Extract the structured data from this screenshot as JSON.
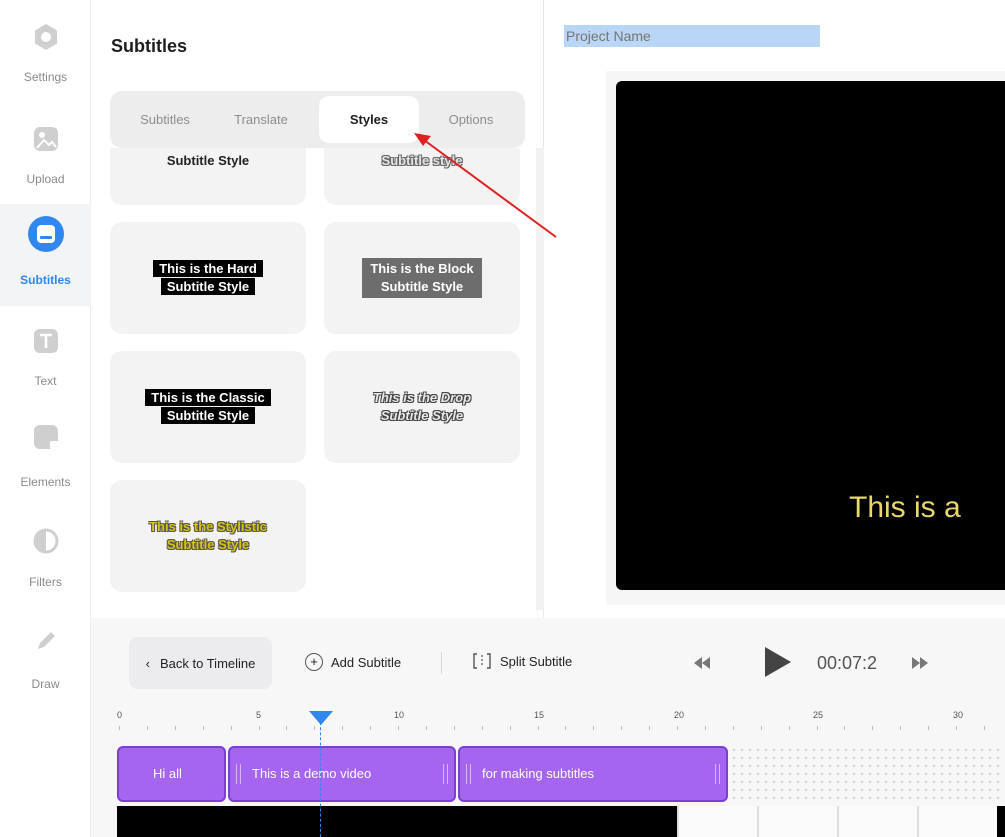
{
  "rail": {
    "items": [
      {
        "label": "Settings",
        "icon": "settings-icon"
      },
      {
        "label": "Upload",
        "icon": "upload-icon"
      },
      {
        "label": "Subtitles",
        "icon": "subtitles-icon"
      },
      {
        "label": "Text",
        "icon": "text-icon"
      },
      {
        "label": "Elements",
        "icon": "elements-icon"
      },
      {
        "label": "Filters",
        "icon": "filters-icon"
      },
      {
        "label": "Draw",
        "icon": "draw-icon"
      }
    ],
    "active": "Subtitles",
    "accent_color": "#2f87ef"
  },
  "panel": {
    "title": "Subtitles",
    "tabs": [
      "Subtitles",
      "Translate",
      "Styles",
      "Options"
    ],
    "active_tab": "Styles",
    "styles": {
      "top_left": "Subtitle Style",
      "top_right": "Subtitle style",
      "hard_line1": "This is the Hard",
      "hard_line2": "Subtitle Style",
      "block_line1": "This is the Block",
      "block_line2": "Subtitle Style",
      "classic_line1": "This is the Classic",
      "classic_line2": "Subtitle Style",
      "drop_line1": "This is the Drop",
      "drop_line2": "Subtitle Style",
      "stylistic_line1": "This is the Stylistic",
      "stylistic_line2": "Subtitle Style"
    }
  },
  "preview": {
    "project_name_placeholder": "Project Name",
    "subtitle_text": "This is a"
  },
  "timeline": {
    "back_label": "Back to Timeline",
    "add_label": "Add Subtitle",
    "split_label": "Split Subtitle",
    "time": "00:07:2",
    "ruler": [
      "0",
      "5",
      "10",
      "15",
      "20",
      "25",
      "30"
    ],
    "clips": [
      "Hi all",
      "This is a demo video",
      "for making subtitles"
    ],
    "clip_color": "#a565f1"
  }
}
